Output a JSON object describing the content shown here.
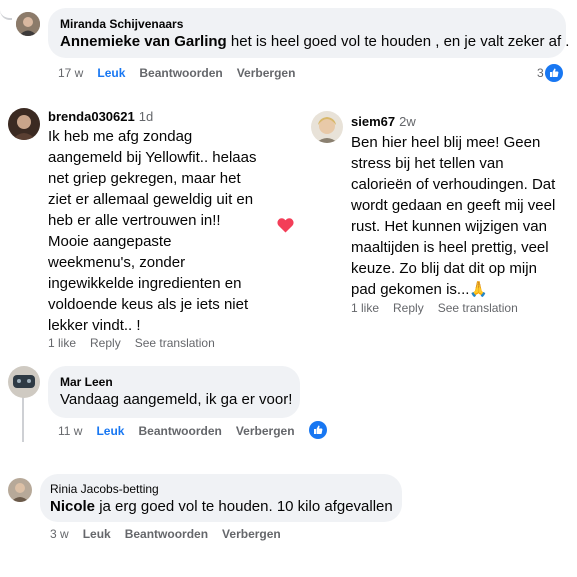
{
  "comment1": {
    "author": "Miranda Schijvenaars",
    "mention": "Annemieke van Garling",
    "text": "het is heel goed vol te houden , en je valt zeker af .",
    "time": "17 w",
    "like": "Leuk",
    "reply": "Beantwoorden",
    "hide": "Verbergen",
    "reactions": "3"
  },
  "review1": {
    "author": "brenda030621",
    "time": "1d",
    "lines": [
      "Ik heb me afg zondag",
      "aangemeld bij Yellowfit.. helaas",
      "net griep gekregen, maar het",
      "ziet er allemaal geweldig uit en",
      "heb er alle vertrouwen in!!",
      "Mooie aangepaste",
      "weekmenu's, zonder",
      "ingewikkelde ingredienten en",
      "voldoende keus als je iets niet",
      "lekker vindt.. !"
    ],
    "likes": "1 like",
    "reply": "Reply",
    "translate": "See translation"
  },
  "review2": {
    "author": "siem67",
    "time": "2w",
    "lines": [
      "Ben hier heel blij mee! Geen",
      "stress bij het tellen van",
      "calorieën of verhoudingen. Dat",
      "wordt gedaan en geeft mij veel",
      "rust. Het kunnen wijzigen van",
      "maaltijden is heel prettig, veel",
      "keuze. Zo blij dat dit op mijn",
      "pad gekomen is...🙏"
    ],
    "likes": "1 like",
    "reply": "Reply",
    "translate": "See translation"
  },
  "comment2": {
    "author": "Mar Leen",
    "text": "Vandaag aangemeld, ik ga er voor!",
    "time": "11 w",
    "like": "Leuk",
    "reply": "Beantwoorden",
    "hide": "Verbergen"
  },
  "comment3": {
    "author": "Rinia Jacobs-betting",
    "mention": "Nicole",
    "text": "ja erg goed vol te houden. 10 kilo afgevallen",
    "time": "3 w",
    "like": "Leuk",
    "reply": "Beantwoorden",
    "hide": "Verbergen"
  },
  "colors": {
    "bubble": "#f0f2f5",
    "facebook_blue": "#1877f2",
    "secondary_text": "#65676b",
    "heart": "#f33e58"
  }
}
